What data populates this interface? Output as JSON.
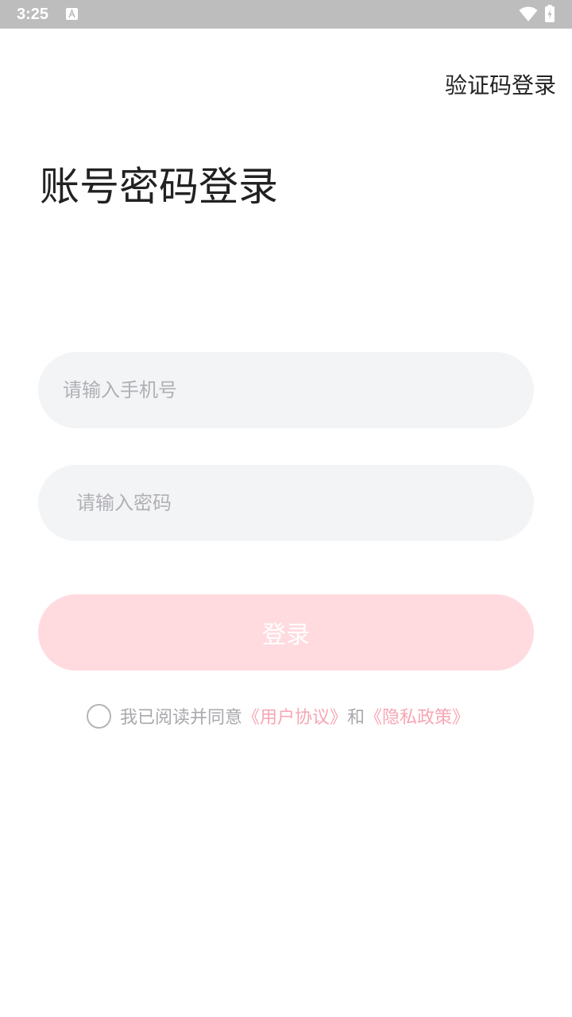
{
  "status_bar": {
    "time": "3:25",
    "icons": [
      "a-icon",
      "wifi-icon",
      "battery-icon"
    ]
  },
  "header": {
    "switch_link": "验证码登录"
  },
  "title": "账号密码登录",
  "form": {
    "phone_placeholder": "请输入手机号",
    "phone_value": "",
    "password_placeholder": "请输入密码",
    "password_value": "",
    "login_button": "登录"
  },
  "agreement": {
    "checked": false,
    "prefix": "我已阅读并同意",
    "user_agreement": "《用户协议》",
    "conjunction": "和",
    "privacy_policy": "《隐私政策》"
  },
  "colors": {
    "status_bar": "#bdbdbd",
    "input_background": "#f3f4f6",
    "button_background": "#ffdbe0",
    "link": "#f7a6b3",
    "hint_text": "#a8a8ad"
  }
}
